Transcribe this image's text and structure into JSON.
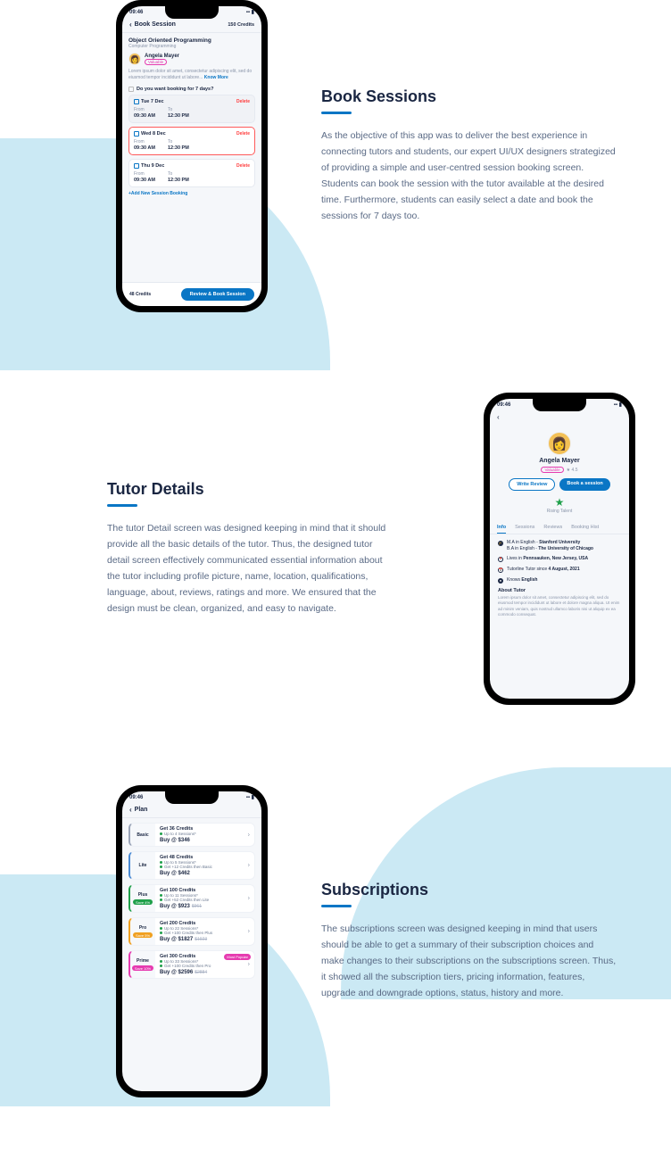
{
  "status_time": "09:46",
  "section1": {
    "heading": "Book Sessions",
    "desc": "As the objective of this app was to deliver the best experience in connecting tutors and students, our expert UI/UX designers strategized of providing a simple and user-centred session booking screen. Students can book the session with the tutor available at the desired time. Furthermore, students can easily select a date and book the sessions for 7 days too.",
    "header_title": "Book Session",
    "header_credits": "150 Credits",
    "course_title": "Object Oriented Programming",
    "course_sub": "Computer Programming",
    "tutor_name": "Angela Mayer",
    "tutor_badge": "Valuable",
    "lorem": "Lorem ipsum dolor sit amet, consectetur adipiscing elit, sed do eiusmod tempor incididunt ut labore...",
    "know_more": "Know More",
    "checkbox_label": "Do you want booking for 7 days?",
    "sessions": [
      {
        "date": "Tue 7 Dec",
        "from": "09:30 AM",
        "to": "12:30 PM",
        "class": "grey"
      },
      {
        "date": "Wed 8 Dec",
        "from": "09:30 AM",
        "to": "12:30 PM",
        "class": "active"
      },
      {
        "date": "Thu 9 Dec",
        "from": "09:30 AM",
        "to": "12:30 PM",
        "class": ""
      }
    ],
    "from_label": "From",
    "to_label": "To",
    "delete_label": "Delete",
    "add_new": "+Add New Session Booking",
    "bottom_credits": "48 Credits",
    "review_btn": "Review & Book Session"
  },
  "section2": {
    "heading": "Tutor Details",
    "desc": "The tutor Detail screen was designed keeping in mind that it should provide all the basic details of the tutor. Thus, the designed tutor detail screen effectively communicated essential information about the tutor including profile picture, name, location, qualifications, language, about, reviews, ratings and more. We ensured that the design must be clean, organized, and easy to navigate.",
    "tutor_name": "Angela Mayer",
    "badge": "Valuable",
    "rating": "4.5",
    "write_review": "Write Review",
    "book_session": "Book a session",
    "rising": "Rising Talent",
    "tabs": [
      "Info",
      "Sessions",
      "Reviews",
      "Booking Hist"
    ],
    "info": {
      "degree1_a": "M.A in English - ",
      "degree1_b": "Stanford University",
      "degree2_a": "B.A in English - ",
      "degree2_b": "The University of Chicago",
      "loc_a": "Lives in ",
      "loc_b": "Pennsauken, New Jersey, USA",
      "since_a": "Tutorline Tutor since ",
      "since_b": "4 August, 2021",
      "lang_a": "Knows ",
      "lang_b": "English"
    },
    "about_h": "About Tutor",
    "about_p": "Lorem ipsum dolor sit amet, consectetur adipiscing elit, sed do eiusmod tempor incididunt ut labore et dolore magna aliqua. Ut enim ad minim veniam, quis nostrud ullamco laboris nisi ut aliquip ex ea commodo consequat."
  },
  "section3": {
    "heading": "Subscriptions",
    "desc": "The subscriptions screen was designed keeping in mind that users should be able to get a summary of their subscription choices and make changes to their subscriptions on the subscriptions screen. Thus, it showed all the subscription tiers, pricing information, features, upgrade and downgrade options, status, history and more.",
    "header_title": "Plan",
    "plans": [
      {
        "name": "Basic",
        "title": "Get 36 Credits",
        "line1": "Up to 4 Sessions*",
        "price": "Buy @ $346",
        "tag": "",
        "tagColor": "",
        "strike": ""
      },
      {
        "name": "Lite",
        "title": "Get 48 Credits",
        "line1": "Up to 5 Sessions*",
        "line2": "Get +12 Credits then Basic",
        "price": "Buy @ $462",
        "tag": "",
        "tagColor": "",
        "strike": ""
      },
      {
        "name": "Plus",
        "title": "Get 100 Credits",
        "line1": "Up to 11 Sessions*",
        "line2": "Get +52 Credits then Lite",
        "price": "Buy @ $923",
        "tag": "Save 4%",
        "tagColor": "#1fa04a",
        "strike": "$961"
      },
      {
        "name": "Pro",
        "title": "Get 200 Credits",
        "line1": "Up to 22 Sessions*",
        "line2": "Get +100 Credits then Plus",
        "price": "Buy @ $1827",
        "tag": "Save 5%",
        "tagColor": "#f0a020",
        "strike": "$1923"
      },
      {
        "name": "Prime",
        "title": "Get 300 Credits",
        "line1": "Up to 33 Sessions*",
        "line2": "Get +100 Credits then Pro",
        "price": "Buy @ $2596",
        "tag": "Save 10%",
        "tagColor": "#e63bb0",
        "strike": "$2884",
        "popular": "Most Popular"
      }
    ]
  }
}
